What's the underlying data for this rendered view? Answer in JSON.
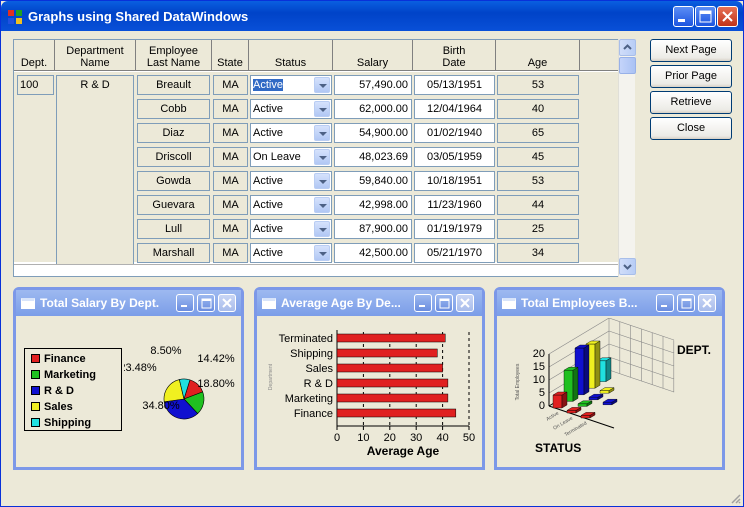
{
  "window": {
    "title": "Graphs using Shared DataWindows",
    "titlebar_color": "#0043C8",
    "buttons": [
      "minimize-icon",
      "maximize-icon",
      "close-icon"
    ]
  },
  "grid": {
    "headers": {
      "dept": "Dept.",
      "dept_name": "Department\nName",
      "emp_last": "Employee\nLast Name",
      "state": "State",
      "status": "Status",
      "salary": "Salary",
      "birth": "Birth\nDate",
      "age": "Age"
    },
    "group": {
      "dept": "100",
      "dept_name": "R & D"
    },
    "rows": [
      {
        "last": "Breault",
        "state": "MA",
        "status": "Active",
        "salary": "57,490.00",
        "birth": "05/13/1951",
        "age": "53",
        "selected": true
      },
      {
        "last": "Cobb",
        "state": "MA",
        "status": "Active",
        "salary": "62,000.00",
        "birth": "12/04/1964",
        "age": "40"
      },
      {
        "last": "Diaz",
        "state": "MA",
        "status": "Active",
        "salary": "54,900.00",
        "birth": "01/02/1940",
        "age": "65"
      },
      {
        "last": "Driscoll",
        "state": "MA",
        "status": "On Leave",
        "salary": "48,023.69",
        "birth": "03/05/1959",
        "age": "45"
      },
      {
        "last": "Gowda",
        "state": "MA",
        "status": "Active",
        "salary": "59,840.00",
        "birth": "10/18/1951",
        "age": "53"
      },
      {
        "last": "Guevara",
        "state": "MA",
        "status": "Active",
        "salary": "42,998.00",
        "birth": "11/23/1960",
        "age": "44"
      },
      {
        "last": "Lull",
        "state": "MA",
        "status": "Active",
        "salary": "87,900.00",
        "birth": "01/19/1979",
        "age": "25"
      },
      {
        "last": "Marshall",
        "state": "MA",
        "status": "Active",
        "salary": "42,500.00",
        "birth": "05/21/1970",
        "age": "34"
      }
    ]
  },
  "side_buttons": {
    "next": "Next Page",
    "prior": "Prior Page",
    "retrieve": "Retrieve",
    "close": "Close"
  },
  "panels": {
    "salary": {
      "title": "Total Salary By Dept.",
      "legend": [
        {
          "label": "Finance",
          "color": "#E02020"
        },
        {
          "label": "Marketing",
          "color": "#20C020"
        },
        {
          "label": "R & D",
          "color": "#1010D0"
        },
        {
          "label": "Sales",
          "color": "#F0F020"
        },
        {
          "label": "Shipping",
          "color": "#20E0E0"
        }
      ]
    },
    "age": {
      "title": "Average Age By De..."
    },
    "employees": {
      "title": "Total Employees B..."
    }
  },
  "chart_data": [
    {
      "type": "pie",
      "title": "Total Salary By Dept.",
      "categories": [
        "Finance",
        "Marketing",
        "R & D",
        "Sales",
        "Shipping"
      ],
      "values": [
        14.42,
        18.8,
        34.8,
        23.48,
        8.5
      ],
      "labels": [
        "14.42%",
        "18.80%",
        "34.80%",
        "23.48%",
        "8.50%"
      ],
      "colors": [
        "#E02020",
        "#20C020",
        "#1010D0",
        "#F0F020",
        "#20E0E0"
      ],
      "legend": "left"
    },
    {
      "type": "bar",
      "orientation": "horizontal",
      "title": "Average Age By De...",
      "categories": [
        "Terminated",
        "Shipping",
        "Sales",
        "R & D",
        "Marketing",
        "Finance"
      ],
      "values": [
        41,
        38,
        40,
        42,
        42,
        45
      ],
      "xlabel": "Average Age",
      "ylabel": "Department",
      "xlim": [
        0,
        50
      ],
      "xticks": [
        0,
        10,
        20,
        30,
        40,
        50
      ],
      "grid": true,
      "color": "#E02020"
    },
    {
      "type": "bar",
      "subtype": "3d",
      "title": "Total Employees B...",
      "xlabel": "STATUS",
      "zlabel": "DEPT.",
      "ylabel": "Total Employees",
      "yticks": [
        "0",
        "5",
        "10",
        "15",
        "20"
      ],
      "categories": [
        "Active",
        "On Leave",
        "Terminated"
      ],
      "series": [
        {
          "color": "#E02020",
          "values": [
            5,
            1,
            1
          ]
        },
        {
          "color": "#20C020",
          "values": [
            12,
            1,
            0
          ]
        },
        {
          "color": "#1010D0",
          "values": [
            18,
            1,
            1
          ]
        },
        {
          "color": "#F0F020",
          "values": [
            17,
            1,
            0
          ]
        },
        {
          "color": "#20E0E0",
          "values": [
            8,
            0,
            0
          ]
        }
      ]
    }
  ]
}
